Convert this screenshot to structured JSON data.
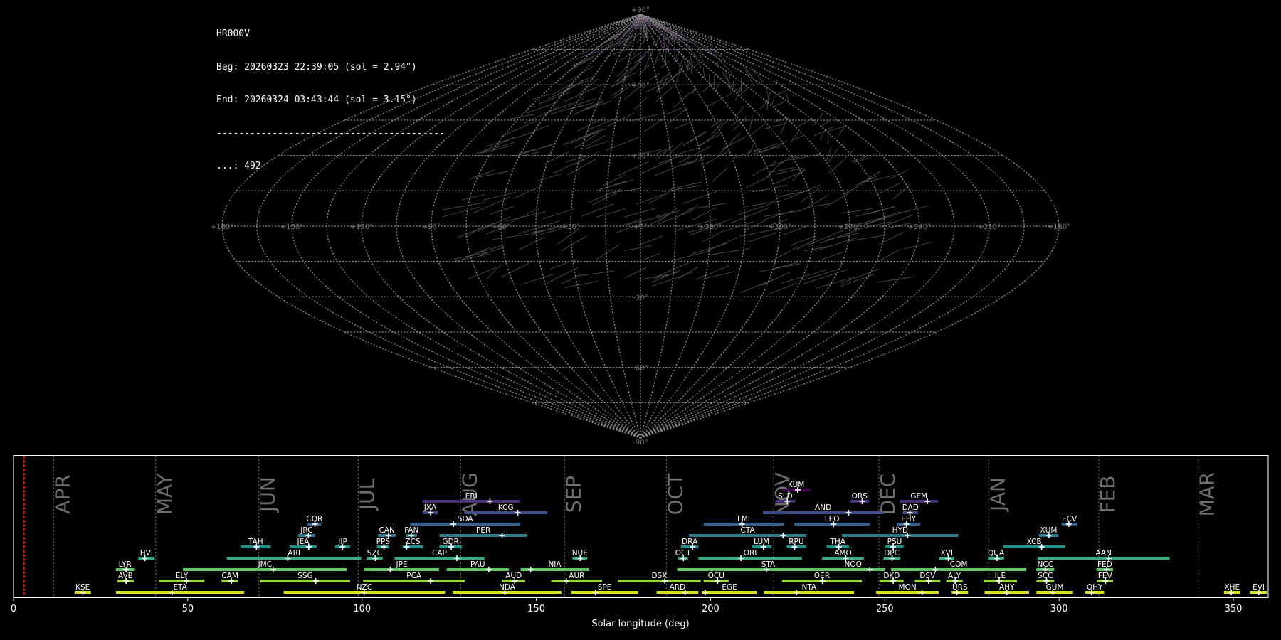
{
  "header": {
    "station": "HR000V",
    "beg": "Beg: 20260323 22:39:05 (sol = 2.94°)",
    "end": "End: 20260324 03:43:44 (sol = 3.15°)",
    "separator": "-----------------------------------------",
    "count": "...: 492"
  },
  "colors": {
    "background": "#000000",
    "grid": "#8a8a8a",
    "meteor_trail": "#9a9a9a",
    "meteor_highlight": "#a070c0",
    "current_marker": "#ff0000",
    "month_text": "#6e6e6e",
    "frame": "#ffffff"
  },
  "chart_data": [
    {
      "type": "sky-map",
      "projection": "sinusoidal",
      "lat_labels": [
        "+90°",
        "+60°",
        "+30°",
        "+0°",
        "-30°",
        "-60°",
        "-90°"
      ],
      "lon_labels": [
        "+180°",
        "+150°",
        "+120°",
        "+90°",
        "+60°",
        "+30°",
        "+0°",
        "+330°",
        "+300°",
        "+270°",
        "+240°",
        "+210°",
        "+180°"
      ],
      "meteor_count": 492
    },
    {
      "type": "range-timeline",
      "xlabel": "Solar longitude (deg)",
      "xlim": [
        0,
        360
      ],
      "xticks": [
        0,
        50,
        100,
        150,
        200,
        250,
        300,
        350
      ],
      "current_solar_longitude": 3.0,
      "months": [
        {
          "label": "APR",
          "start": 11.5
        },
        {
          "label": "MAY",
          "start": 40.8
        },
        {
          "label": "JUN",
          "start": 70.4
        },
        {
          "label": "JUL",
          "start": 98.9
        },
        {
          "label": "AUG",
          "start": 128.3
        },
        {
          "label": "SEP",
          "start": 158.1
        },
        {
          "label": "OCT",
          "start": 187.3
        },
        {
          "label": "NOV",
          "start": 218.1
        },
        {
          "label": "DEC",
          "start": 248.3
        },
        {
          "label": "JAN",
          "start": 279.8
        },
        {
          "label": "FEB",
          "start": 311.4
        },
        {
          "label": "MAR",
          "start": 339.9
        }
      ],
      "showers": [
        {
          "code": "KUM",
          "start": 220.5,
          "end": 228.6,
          "peak": 225.0,
          "row": 9
        },
        {
          "code": "ERI",
          "start": 117.4,
          "end": 145.3,
          "peak": 136.7,
          "row": 8
        },
        {
          "code": "SLD",
          "start": 218.6,
          "end": 224.3,
          "peak": 222.0,
          "row": 8
        },
        {
          "code": "ORS",
          "start": 240.0,
          "end": 245.5,
          "peak": 243.5,
          "row": 8
        },
        {
          "code": "GEM",
          "start": 254.3,
          "end": 265.3,
          "peak": 262.2,
          "row": 8
        },
        {
          "code": "JXA",
          "start": 117.4,
          "end": 121.7,
          "peak": 119.7,
          "row": 7
        },
        {
          "code": "KCG",
          "start": 129.3,
          "end": 153.2,
          "peak": 144.7,
          "row": 7
        },
        {
          "code": "AND",
          "start": 215.0,
          "end": 249.6,
          "peak": 239.6,
          "row": 7
        },
        {
          "code": "DAD",
          "start": 255.1,
          "end": 259.6,
          "peak": 257.2,
          "row": 7
        },
        {
          "code": "COR",
          "start": 84.4,
          "end": 88.3,
          "peak": 86.5,
          "row": 6
        },
        {
          "code": "SDA",
          "start": 113.8,
          "end": 145.4,
          "peak": 126.2,
          "row": 6
        },
        {
          "code": "LMI",
          "start": 198.0,
          "end": 221.0,
          "peak": 209.0,
          "row": 6
        },
        {
          "code": "LEO",
          "start": 224.0,
          "end": 245.7,
          "peak": 235.3,
          "row": 6
        },
        {
          "code": "EHY",
          "start": 253.4,
          "end": 260.2,
          "peak": 256.2,
          "row": 6
        },
        {
          "code": "ECV",
          "start": 300.7,
          "end": 305.2,
          "peak": 302.8,
          "row": 6
        },
        {
          "code": "JRC",
          "start": 81.7,
          "end": 86.5,
          "peak": 84.6,
          "row": 5
        },
        {
          "code": "CAN",
          "start": 104.6,
          "end": 109.7,
          "peak": 107.6,
          "row": 5
        },
        {
          "code": "FAN",
          "start": 112.6,
          "end": 115.8,
          "peak": 114.1,
          "row": 5
        },
        {
          "code": "PER",
          "start": 122.2,
          "end": 147.4,
          "peak": 140.2,
          "row": 5
        },
        {
          "code": "CTA",
          "start": 193.8,
          "end": 227.5,
          "peak": 220.8,
          "row": 5
        },
        {
          "code": "HYD",
          "start": 237.7,
          "end": 271.1,
          "peak": 256.5,
          "row": 5
        },
        {
          "code": "XUM",
          "start": 294.2,
          "end": 299.8,
          "peak": 297.1,
          "row": 5
        },
        {
          "code": "TAH",
          "start": 65.2,
          "end": 73.8,
          "peak": 69.7,
          "row": 4
        },
        {
          "code": "JEA",
          "start": 79.2,
          "end": 87.0,
          "peak": 84.7,
          "row": 4
        },
        {
          "code": "JIP",
          "start": 92.3,
          "end": 96.6,
          "peak": 94.4,
          "row": 4
        },
        {
          "code": "PPS",
          "start": 104.3,
          "end": 107.8,
          "peak": 106.3,
          "row": 4
        },
        {
          "code": "ZCS",
          "start": 111.6,
          "end": 117.5,
          "peak": 112.8,
          "row": 4
        },
        {
          "code": "GDR",
          "start": 122.2,
          "end": 128.6,
          "peak": 125.6,
          "row": 4
        },
        {
          "code": "DRA",
          "start": 191.5,
          "end": 196.5,
          "peak": 194.8,
          "row": 4
        },
        {
          "code": "LUM",
          "start": 211.8,
          "end": 217.5,
          "peak": 215.2,
          "row": 4
        },
        {
          "code": "RPU",
          "start": 221.8,
          "end": 227.4,
          "peak": 224.1,
          "row": 4
        },
        {
          "code": "THA",
          "start": 233.3,
          "end": 239.7,
          "peak": 236.8,
          "row": 4
        },
        {
          "code": "PSU",
          "start": 250.2,
          "end": 255.4,
          "peak": 252.4,
          "row": 4
        },
        {
          "code": "XCB",
          "start": 284.0,
          "end": 301.7,
          "peak": 295.0,
          "row": 4
        },
        {
          "code": "HVI",
          "start": 35.8,
          "end": 40.5,
          "peak": 37.7,
          "row": 3
        },
        {
          "code": "ARI",
          "start": 61.2,
          "end": 99.8,
          "peak": 78.7,
          "row": 3
        },
        {
          "code": "SZC",
          "start": 101.3,
          "end": 105.9,
          "peak": 103.8,
          "row": 3
        },
        {
          "code": "CAP",
          "start": 109.3,
          "end": 135.1,
          "peak": 127.2,
          "row": 3
        },
        {
          "code": "NUE",
          "start": 160.4,
          "end": 164.6,
          "peak": 162.6,
          "row": 3
        },
        {
          "code": "OCT",
          "start": 190.7,
          "end": 193.5,
          "peak": 192.2,
          "row": 3
        },
        {
          "code": "ORI",
          "start": 196.5,
          "end": 226.2,
          "peak": 208.7,
          "row": 3
        },
        {
          "code": "AMO",
          "start": 232.0,
          "end": 244.0,
          "peak": 238.8,
          "row": 3
        },
        {
          "code": "DPC",
          "start": 249.6,
          "end": 254.4,
          "peak": 252.1,
          "row": 3
        },
        {
          "code": "XVI",
          "start": 265.6,
          "end": 269.9,
          "peak": 268.2,
          "row": 3
        },
        {
          "code": "QUA",
          "start": 279.6,
          "end": 284.2,
          "peak": 282.2,
          "row": 3
        },
        {
          "code": "AAN",
          "start": 293.8,
          "end": 331.7,
          "peak": 314.3,
          "row": 3
        },
        {
          "code": "LYR",
          "start": 29.4,
          "end": 34.6,
          "peak": 32.3,
          "row": 2
        },
        {
          "code": "JMC",
          "start": 48.6,
          "end": 95.7,
          "peak": 74.5,
          "row": 2
        },
        {
          "code": "JPE",
          "start": 100.7,
          "end": 122.1,
          "peak": 108.1,
          "row": 2
        },
        {
          "code": "PAU",
          "start": 124.3,
          "end": 142.1,
          "peak": 136.4,
          "row": 2
        },
        {
          "code": "NIA",
          "start": 145.5,
          "end": 165.1,
          "peak": 148.4,
          "row": 2
        },
        {
          "code": "STA",
          "start": 190.4,
          "end": 242.7,
          "peak": 216.0,
          "row": 2
        },
        {
          "code": "NOO",
          "start": 231.7,
          "end": 250.1,
          "peak": 245.7,
          "row": 2
        },
        {
          "code": "COM",
          "start": 251.8,
          "end": 290.6,
          "peak": 264.5,
          "row": 2
        },
        {
          "code": "NCC",
          "start": 293.5,
          "end": 298.6,
          "peak": 296.0,
          "row": 2
        },
        {
          "code": "FED",
          "start": 310.7,
          "end": 315.5,
          "peak": 313.7,
          "row": 2
        },
        {
          "code": "AVB",
          "start": 29.8,
          "end": 34.5,
          "peak": 32.3,
          "row": 1
        },
        {
          "code": "ELY",
          "start": 41.8,
          "end": 54.8,
          "peak": 49.6,
          "row": 1
        },
        {
          "code": "CAM",
          "start": 59.7,
          "end": 64.5,
          "peak": 62.5,
          "row": 1
        },
        {
          "code": "SSG",
          "start": 70.8,
          "end": 96.6,
          "peak": 86.7,
          "row": 1
        },
        {
          "code": "PCA",
          "start": 100.3,
          "end": 129.5,
          "peak": 119.7,
          "row": 1
        },
        {
          "code": "AUD",
          "start": 140.2,
          "end": 146.8,
          "peak": 143.8,
          "row": 1
        },
        {
          "code": "AUR",
          "start": 154.3,
          "end": 168.9,
          "peak": 158.6,
          "row": 1
        },
        {
          "code": "DSX",
          "start": 173.4,
          "end": 197.2,
          "peak": 186.9,
          "row": 1
        },
        {
          "code": "OCU",
          "start": 198.0,
          "end": 205.2,
          "peak": 202.0,
          "row": 1
        },
        {
          "code": "OER",
          "start": 220.5,
          "end": 243.4,
          "peak": 232.1,
          "row": 1
        },
        {
          "code": "DKD",
          "start": 248.5,
          "end": 255.4,
          "peak": 252.4,
          "row": 1
        },
        {
          "code": "DSV",
          "start": 258.6,
          "end": 265.9,
          "peak": 262.6,
          "row": 1
        },
        {
          "code": "ALY",
          "start": 267.6,
          "end": 272.3,
          "peak": 270.2,
          "row": 1
        },
        {
          "code": "ILE",
          "start": 278.3,
          "end": 287.9,
          "peak": 282.8,
          "row": 1
        },
        {
          "code": "SCC",
          "start": 293.5,
          "end": 298.6,
          "peak": 296.4,
          "row": 1
        },
        {
          "code": "FEV",
          "start": 310.9,
          "end": 315.5,
          "peak": 313.3,
          "row": 1
        },
        {
          "code": "KSE",
          "start": 17.5,
          "end": 22.2,
          "peak": 19.9,
          "row": 0
        },
        {
          "code": "ETA",
          "start": 29.4,
          "end": 66.2,
          "peak": 45.5,
          "row": 0
        },
        {
          "code": "NZC",
          "start": 77.5,
          "end": 123.8,
          "peak": 100.6,
          "row": 0
        },
        {
          "code": "NDA",
          "start": 126.0,
          "end": 157.2,
          "peak": 141.0,
          "row": 0
        },
        {
          "code": "SPE",
          "start": 160.0,
          "end": 179.2,
          "peak": 167.0,
          "row": 0
        },
        {
          "code": "ARD",
          "start": 184.5,
          "end": 196.5,
          "peak": 192.7,
          "row": 0
        },
        {
          "code": "EGE",
          "start": 197.5,
          "end": 213.4,
          "peak": 198.5,
          "row": 0
        },
        {
          "code": "NTA",
          "start": 215.3,
          "end": 241.2,
          "peak": 224.7,
          "row": 0
        },
        {
          "code": "MON",
          "start": 247.5,
          "end": 265.5,
          "peak": 260.7,
          "row": 0
        },
        {
          "code": "URS",
          "start": 269.2,
          "end": 273.9,
          "peak": 270.7,
          "row": 0
        },
        {
          "code": "AHY",
          "start": 278.6,
          "end": 291.4,
          "peak": 285.0,
          "row": 0
        },
        {
          "code": "GUM",
          "start": 293.5,
          "end": 304.0,
          "peak": 298.2,
          "row": 0
        },
        {
          "code": "OHY",
          "start": 307.5,
          "end": 312.9,
          "peak": 309.3,
          "row": 0
        },
        {
          "code": "XHE",
          "start": 347.3,
          "end": 352.0,
          "peak": 349.4,
          "row": 0
        },
        {
          "code": "EVI",
          "start": 354.8,
          "end": 359.7,
          "peak": 357.3,
          "row": 0
        }
      ]
    }
  ]
}
